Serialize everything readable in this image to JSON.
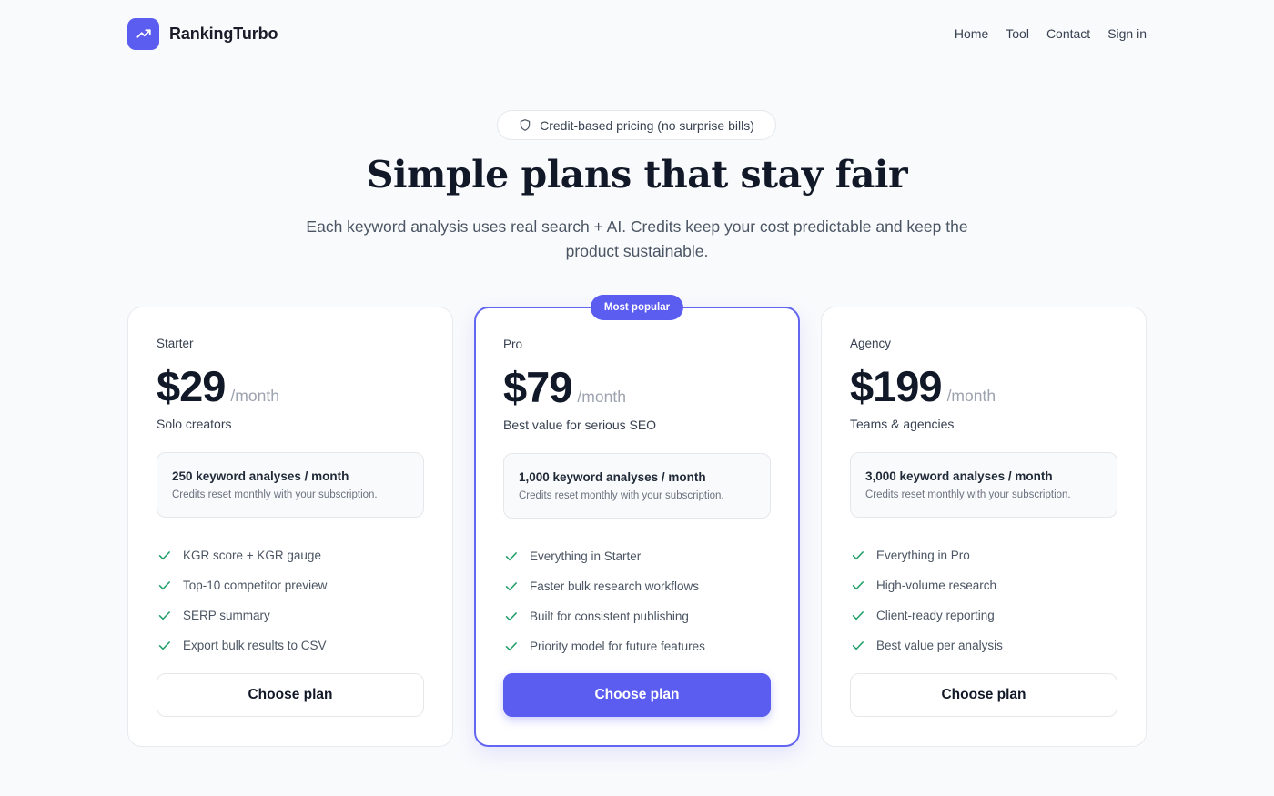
{
  "brand": {
    "name": "RankingTurbo",
    "logo_icon": "trending-up-icon",
    "accent": "#5b5cf0"
  },
  "nav": {
    "links": [
      "Home",
      "Tool",
      "Contact",
      "Sign in"
    ]
  },
  "hero": {
    "pill_icon": "shield-icon",
    "pill_text": "Credit-based pricing (no surprise bills)",
    "title": "Simple plans that stay fair",
    "subtitle": "Each keyword analysis uses real search + AI. Credits keep your cost predictable and keep the product sustainable."
  },
  "plans": [
    {
      "name": "Starter",
      "price": "$29",
      "period": "/month",
      "tagline": "Solo creators",
      "credits_title": "250 keyword analyses / month",
      "credits_note": "Credits reset monthly with your subscription.",
      "features": [
        "KGR score + KGR gauge",
        "Top-10 competitor preview",
        "SERP summary",
        "Export bulk results to CSV"
      ],
      "button": "Choose plan"
    },
    {
      "name": "Pro",
      "badge": "Most popular",
      "price": "$79",
      "period": "/month",
      "tagline": "Best value for serious SEO",
      "credits_title": "1,000 keyword analyses / month",
      "credits_note": "Credits reset monthly with your subscription.",
      "features": [
        "Everything in Starter",
        "Faster bulk research workflows",
        "Built for consistent publishing",
        "Priority model for future features"
      ],
      "button": "Choose plan"
    },
    {
      "name": "Agency",
      "price": "$199",
      "period": "/month",
      "tagline": "Teams & agencies",
      "credits_title": "3,000 keyword analyses / month",
      "credits_note": "Credits reset monthly with your subscription.",
      "features": [
        "Everything in Pro",
        "High-volume research",
        "Client-ready reporting",
        "Best value per analysis"
      ],
      "button": "Choose plan"
    }
  ],
  "colors": {
    "check": "#22a06b",
    "accent": "#5b5cf0",
    "background": "#f9fafc"
  }
}
